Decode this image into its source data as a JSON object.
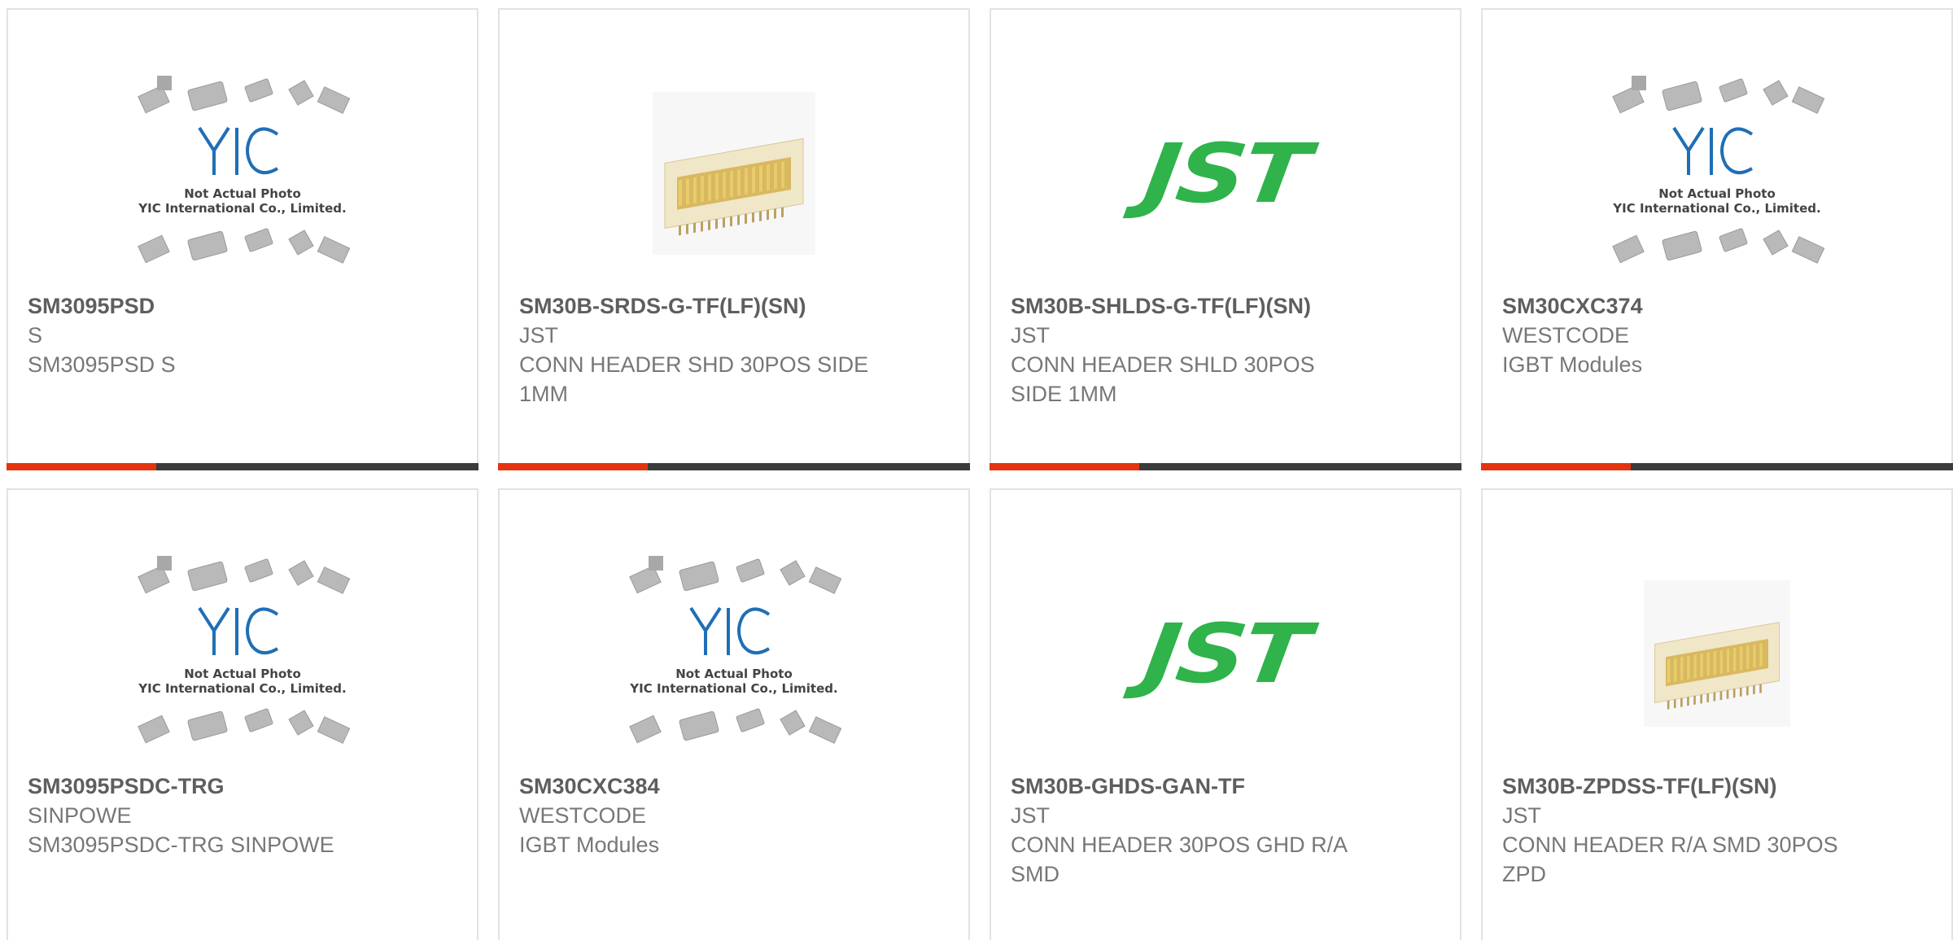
{
  "products": [
    {
      "part": "SM3095PSD",
      "manufacturer": "S",
      "description": "SM3095PSD S",
      "image": "yic-placeholder",
      "image_caption": [
        "Not Actual Photo",
        "YIC International Co., Limited."
      ]
    },
    {
      "part": "SM30B-SRDS-G-TF(LF)(SN)",
      "manufacturer": "JST",
      "description": "CONN HEADER SHD 30POS SIDE 1MM",
      "image": "connector-photo"
    },
    {
      "part": "SM30B-SHLDS-G-TF(LF)(SN)",
      "manufacturer": "JST",
      "description": "CONN HEADER SHLD 30POS SIDE 1MM",
      "image": "jst-logo",
      "logo_text": "JST"
    },
    {
      "part": "SM30CXC374",
      "manufacturer": "WESTCODE",
      "description": "IGBT Modules",
      "image": "yic-placeholder",
      "image_caption": [
        "Not Actual Photo",
        "YIC International Co., Limited."
      ]
    },
    {
      "part": "SM3095PSDC-TRG",
      "manufacturer": "SINPOWE",
      "description": "SM3095PSDC-TRG SINPOWE",
      "image": "yic-placeholder",
      "image_caption": [
        "Not Actual Photo",
        "YIC International Co., Limited."
      ]
    },
    {
      "part": "SM30CXC384",
      "manufacturer": "WESTCODE",
      "description": "IGBT Modules",
      "image": "yic-placeholder",
      "image_caption": [
        "Not Actual Photo",
        "YIC International Co., Limited."
      ]
    },
    {
      "part": "SM30B-GHDS-GAN-TF",
      "manufacturer": "JST",
      "description": "CONN HEADER 30POS GHD R/A SMD",
      "image": "jst-logo",
      "logo_text": "JST"
    },
    {
      "part": "SM30B-ZPDSS-TF(LF)(SN)",
      "manufacturer": "JST",
      "description": "CONN HEADER R/A SMD 30POS ZPD",
      "image": "connector-photo-small"
    }
  ],
  "colors": {
    "accent": "#e4340f",
    "bar": "#3c3c3c",
    "jst_green": "#2fb34a",
    "yic_blue": "#1f6fb5"
  }
}
